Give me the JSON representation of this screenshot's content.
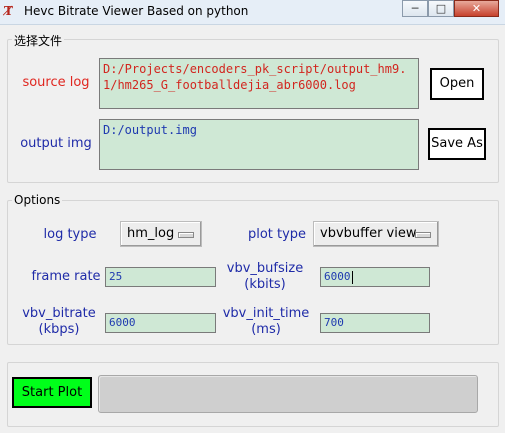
{
  "window": {
    "title": "Hevc Bitrate Viewer Based on python",
    "minimize_label": "─",
    "maximize_label": "□",
    "close_label": "✕"
  },
  "file_group": {
    "legend": "选择文件",
    "source_log_label": "source log",
    "source_log_value": "D:/Projects/encoders_pk_script/output_hm9.1/hm265_G_footballdejia_abr6000.log",
    "open_button": "Open",
    "output_img_label": "output img",
    "output_img_value": "D:/output.img",
    "save_as_button": "Save As"
  },
  "options_group": {
    "legend": "Options",
    "log_type_label": "log type",
    "log_type_value": "hm_log",
    "plot_type_label": "plot type",
    "plot_type_value": "vbvbuffer view",
    "frame_rate_label": "frame rate",
    "frame_rate_value": "25",
    "vbv_bufsize_label_1": "vbv_bufsize",
    "vbv_bufsize_label_2": "(kbits)",
    "vbv_bufsize_value": "6000",
    "vbv_bitrate_label_1": "vbv_bitrate",
    "vbv_bitrate_label_2": "(kbps)",
    "vbv_bitrate_value": "6000",
    "vbv_init_time_label_1": "vbv_init_time",
    "vbv_init_time_label_2": "(ms)",
    "vbv_init_time_value": "700"
  },
  "bottom": {
    "start_plot_button": "Start Plot",
    "progress": 0
  },
  "colors": {
    "label_red": "#e0261f",
    "label_blue": "#1f2ba8",
    "entry_bg": "#cfe8d5",
    "start_button_bg": "#00ff1a"
  }
}
